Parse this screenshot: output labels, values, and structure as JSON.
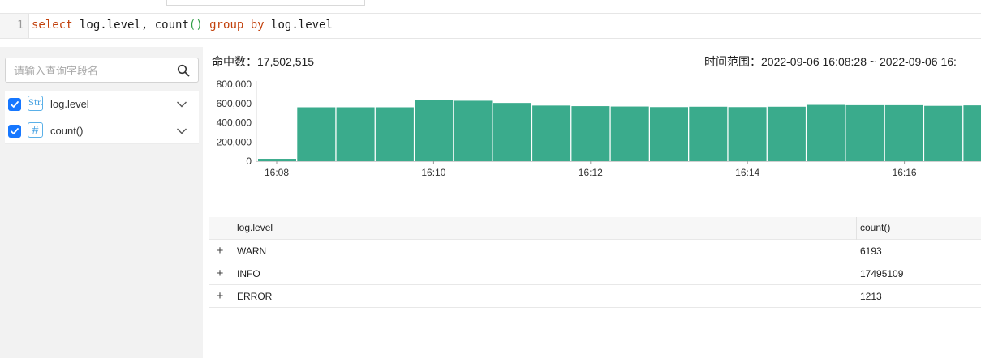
{
  "query": {
    "line_number": "1",
    "tokens": {
      "select": "select",
      "field1": " log.level, ",
      "count": "count",
      "parens": "()",
      "group": " group",
      "by": " by",
      "field2": " log.level"
    }
  },
  "sidebar": {
    "search_placeholder": "请输入查询字段名",
    "search_icon": "search-icon",
    "fields": [
      {
        "type_icon": "Str.",
        "label": "log.level",
        "checked": true
      },
      {
        "type_icon": "#",
        "label": "count()",
        "checked": true
      }
    ]
  },
  "summary": {
    "hits_label": "命中数：",
    "hits_value": "17,502,515",
    "range_label": "时间范围：",
    "range_value": "2022-09-06 16:08:28 ~ 2022-09-06 16:"
  },
  "chart_data": {
    "type": "bar",
    "color": "#3aab8c",
    "y_ticks": [
      "800,000",
      "600,000",
      "400,000",
      "200,000",
      "0"
    ],
    "ylim": [
      0,
      800000
    ],
    "x_ticks": [
      "16:08",
      "16:10",
      "16:12",
      "16:14",
      "16:16"
    ],
    "values": [
      25000,
      560000,
      560000,
      560000,
      640000,
      628000,
      605000,
      578000,
      572000,
      568000,
      562000,
      566000,
      562000,
      566000,
      585000,
      582000,
      582000,
      575000,
      580000
    ]
  },
  "table": {
    "headers": [
      "log.level",
      "count()"
    ],
    "rows": [
      {
        "level": "WARN",
        "count": "6193"
      },
      {
        "level": "INFO",
        "count": "17495109"
      },
      {
        "level": "ERROR",
        "count": "1213"
      }
    ],
    "expand_symbol": "+"
  }
}
